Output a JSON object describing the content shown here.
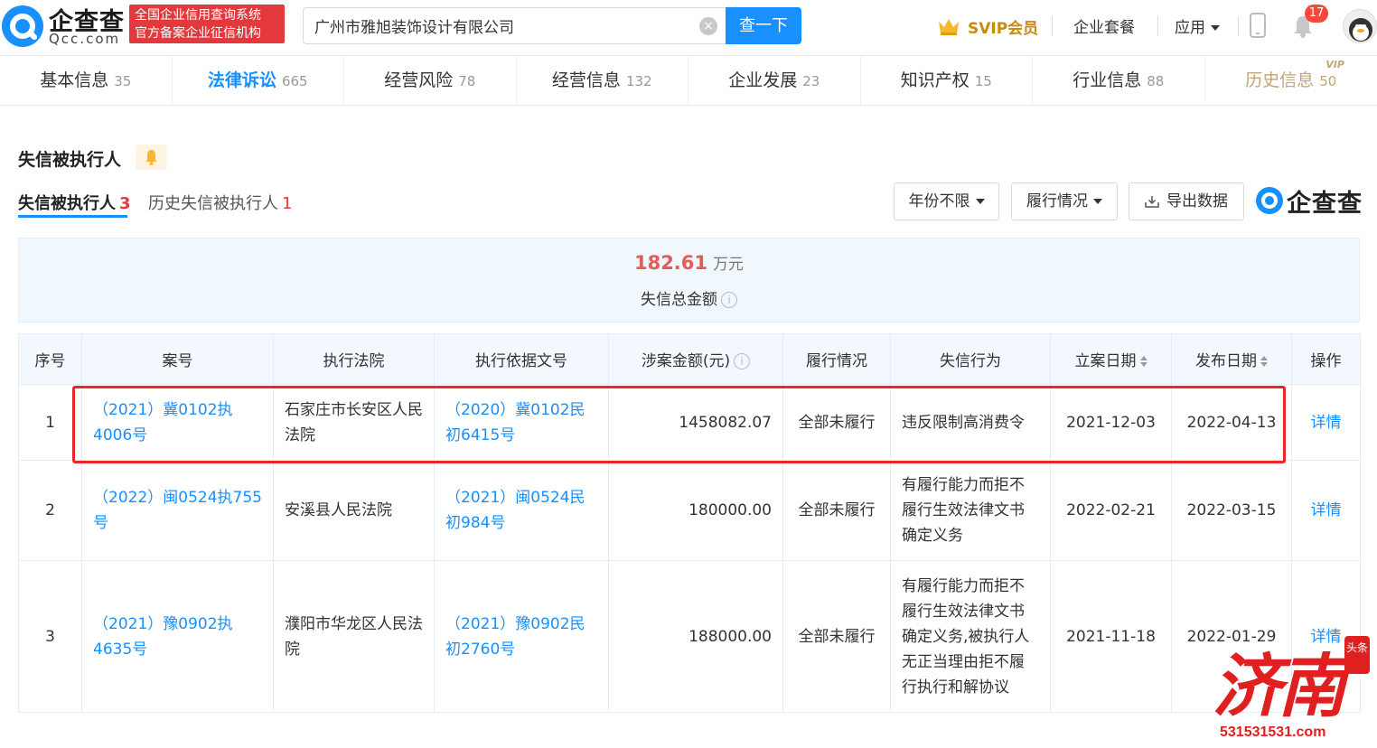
{
  "header": {
    "logo_cn": "企查查",
    "logo_en": "Qcc.com",
    "slogan_line1": "全国企业信用查询系统",
    "slogan_line2": "官方备案企业征信机构",
    "search_value": "广州市雅旭装饰设计有限公司",
    "search_button": "查一下",
    "svip_label": "SVIP会员",
    "package_link": "企业套餐",
    "apps_link": "应用",
    "notification_count": "17"
  },
  "tabs": [
    {
      "label": "基本信息",
      "count": "35"
    },
    {
      "label": "法律诉讼",
      "count": "665"
    },
    {
      "label": "经营风险",
      "count": "78"
    },
    {
      "label": "经营信息",
      "count": "132"
    },
    {
      "label": "企业发展",
      "count": "23"
    },
    {
      "label": "知识产权",
      "count": "15"
    },
    {
      "label": "行业信息",
      "count": "88"
    },
    {
      "label": "历史信息",
      "count": "50",
      "tag": "VIP"
    }
  ],
  "section": {
    "title": "失信被执行人",
    "subtabs": [
      {
        "label": "失信被执行人",
        "count": "3"
      },
      {
        "label": "历史失信被执行人",
        "count": "1"
      }
    ],
    "filter_year": "年份不限",
    "filter_status": "履行情况",
    "export_label": "导出数据",
    "watermark_logo": "企查查"
  },
  "summary": {
    "amount": "182.61",
    "unit": "万元",
    "label": "失信总金额"
  },
  "table": {
    "headers": [
      "序号",
      "案号",
      "执行法院",
      "执行依据文号",
      "涉案金额(元)",
      "履行情况",
      "失信行为",
      "立案日期",
      "发布日期",
      "操作"
    ],
    "rows": [
      {
        "index": "1",
        "case_no": "（2021）冀0102执4006号",
        "court": "石家庄市长安区人民法院",
        "basis_no": "（2020）冀0102民初6415号",
        "amount": "1458082.07",
        "status": "全部未履行",
        "behavior": "违反限制高消费令",
        "filed": "2021-12-03",
        "published": "2022-04-13",
        "action": "详情"
      },
      {
        "index": "2",
        "case_no": "（2022）闽0524执755号",
        "court": "安溪县人民法院",
        "basis_no": "（2021）闽0524民初984号",
        "amount": "180000.00",
        "status": "全部未履行",
        "behavior": "有履行能力而拒不履行生效法律文书确定义务",
        "filed": "2022-02-21",
        "published": "2022-03-15",
        "action": "详情"
      },
      {
        "index": "3",
        "case_no": "（2021）豫0902执4635号",
        "court": "濮阳市华龙区人民法院",
        "basis_no": "（2021）豫0902民初2760号",
        "amount": "188000.00",
        "status": "全部未履行",
        "behavior": "有履行能力而拒不履行生效法律文书确定义务,被执行人无正当理由拒不履行执行和解协议",
        "filed": "2021-11-18",
        "published": "2022-01-29",
        "action": "详情"
      }
    ]
  },
  "overlay": {
    "big_text": "济南",
    "seal_text": "头条",
    "url": "531531531.com"
  },
  "colors": {
    "brand_blue": "#1890ff",
    "alert_red": "#e4393c",
    "highlight_border": "#e8272c",
    "vip_gold": "#c4a476"
  }
}
